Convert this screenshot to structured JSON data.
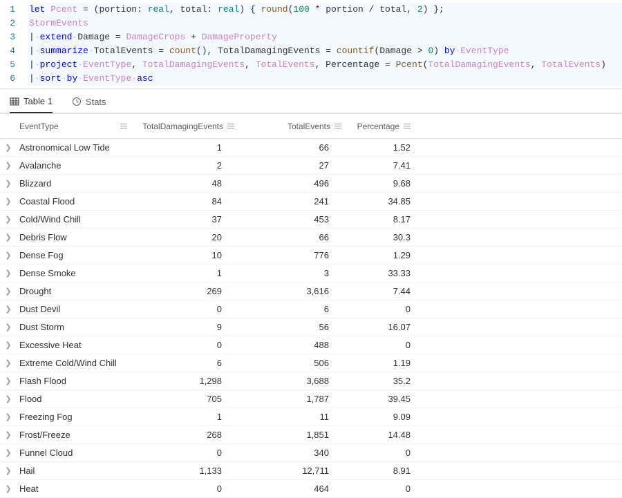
{
  "editor": {
    "lines": [
      {
        "num": "1",
        "tokens": [
          {
            "t": "let ",
            "c": "tok-kw"
          },
          {
            "t": "Pcent",
            "c": "tok-ident"
          },
          {
            "t": " = (",
            "c": "tok-op"
          },
          {
            "t": "portion",
            "c": "tok-op"
          },
          {
            "t": ": ",
            "c": "tok-op"
          },
          {
            "t": "real",
            "c": "tok-type"
          },
          {
            "t": ", ",
            "c": "tok-op"
          },
          {
            "t": "total",
            "c": "tok-op"
          },
          {
            "t": ": ",
            "c": "tok-op"
          },
          {
            "t": "real",
            "c": "tok-type"
          },
          {
            "t": ") { ",
            "c": "tok-op"
          },
          {
            "t": "round",
            "c": "tok-func"
          },
          {
            "t": "(",
            "c": "tok-op"
          },
          {
            "t": "100",
            "c": "tok-num"
          },
          {
            "t": " * portion / total, ",
            "c": "tok-op"
          },
          {
            "t": "2",
            "c": "tok-num"
          },
          {
            "t": ") };",
            "c": "tok-op"
          }
        ]
      },
      {
        "num": "2",
        "tokens": [
          {
            "t": "StormEvents",
            "c": "tok-ident"
          }
        ]
      },
      {
        "num": "3",
        "tokens": [
          {
            "t": "|",
            "c": "tok-pipe"
          },
          {
            "t": "·",
            "c": "tok-dot"
          },
          {
            "t": "extend",
            "c": "tok-kw"
          },
          {
            "t": "·",
            "c": "tok-dot"
          },
          {
            "t": "Damage",
            "c": "tok-op"
          },
          {
            "t": " = ",
            "c": "tok-op"
          },
          {
            "t": "DamageCrops",
            "c": "tok-ident"
          },
          {
            "t": " + ",
            "c": "tok-op"
          },
          {
            "t": "DamageProperty",
            "c": "tok-ident"
          }
        ]
      },
      {
        "num": "4",
        "tokens": [
          {
            "t": "|",
            "c": "tok-pipe"
          },
          {
            "t": "·",
            "c": "tok-dot"
          },
          {
            "t": "summarize",
            "c": "tok-kw"
          },
          {
            "t": "·",
            "c": "tok-dot"
          },
          {
            "t": "TotalEvents",
            "c": "tok-op"
          },
          {
            "t": " = ",
            "c": "tok-op"
          },
          {
            "t": "count",
            "c": "tok-func"
          },
          {
            "t": "(), ",
            "c": "tok-op"
          },
          {
            "t": "TotalDamagingEvents",
            "c": "tok-op"
          },
          {
            "t": " = ",
            "c": "tok-op"
          },
          {
            "t": "countif",
            "c": "tok-func"
          },
          {
            "t": "(",
            "c": "tok-op"
          },
          {
            "t": "Damage",
            "c": "tok-op"
          },
          {
            "t": " > ",
            "c": "tok-op"
          },
          {
            "t": "0",
            "c": "tok-num"
          },
          {
            "t": ") ",
            "c": "tok-op"
          },
          {
            "t": "by",
            "c": "tok-by"
          },
          {
            "t": "·",
            "c": "tok-dot"
          },
          {
            "t": "EventType",
            "c": "tok-ident"
          }
        ]
      },
      {
        "num": "5",
        "tokens": [
          {
            "t": "|",
            "c": "tok-pipe"
          },
          {
            "t": "·",
            "c": "tok-dot"
          },
          {
            "t": "project",
            "c": "tok-kw"
          },
          {
            "t": "·",
            "c": "tok-dot"
          },
          {
            "t": "EventType",
            "c": "tok-ident"
          },
          {
            "t": ", ",
            "c": "tok-op"
          },
          {
            "t": "TotalDamagingEvents",
            "c": "tok-ident"
          },
          {
            "t": ", ",
            "c": "tok-op"
          },
          {
            "t": "TotalEvents",
            "c": "tok-ident"
          },
          {
            "t": ", ",
            "c": "tok-op"
          },
          {
            "t": "Percentage",
            "c": "tok-op"
          },
          {
            "t": " = ",
            "c": "tok-op"
          },
          {
            "t": "Pcent",
            "c": "tok-func"
          },
          {
            "t": "(",
            "c": "tok-op"
          },
          {
            "t": "TotalDamagingEvents",
            "c": "tok-ident"
          },
          {
            "t": ", ",
            "c": "tok-op"
          },
          {
            "t": "TotalEvents",
            "c": "tok-ident"
          },
          {
            "t": ")",
            "c": "tok-op"
          }
        ]
      },
      {
        "num": "6",
        "tokens": [
          {
            "t": "|",
            "c": "tok-pipe"
          },
          {
            "t": "·",
            "c": "tok-dot"
          },
          {
            "t": "sort",
            "c": "tok-kw"
          },
          {
            "t": "·",
            "c": "tok-dot"
          },
          {
            "t": "by",
            "c": "tok-by"
          },
          {
            "t": "·",
            "c": "tok-dot"
          },
          {
            "t": "EventType",
            "c": "tok-ident"
          },
          {
            "t": "·",
            "c": "tok-dot"
          },
          {
            "t": "asc",
            "c": "tok-asc"
          }
        ]
      }
    ]
  },
  "tabs": {
    "table1": "Table 1",
    "stats": "Stats"
  },
  "table": {
    "columns": {
      "eventtype": "EventType",
      "totaldamaging": "TotalDamagingEvents",
      "totalevents": "TotalEvents",
      "percentage": "Percentage"
    },
    "rows": [
      {
        "event": "Astronomical Low Tide",
        "damaging": "1",
        "total": "66",
        "pct": "1.52"
      },
      {
        "event": "Avalanche",
        "damaging": "2",
        "total": "27",
        "pct": "7.41"
      },
      {
        "event": "Blizzard",
        "damaging": "48",
        "total": "496",
        "pct": "9.68"
      },
      {
        "event": "Coastal Flood",
        "damaging": "84",
        "total": "241",
        "pct": "34.85"
      },
      {
        "event": "Cold/Wind Chill",
        "damaging": "37",
        "total": "453",
        "pct": "8.17"
      },
      {
        "event": "Debris Flow",
        "damaging": "20",
        "total": "66",
        "pct": "30.3"
      },
      {
        "event": "Dense Fog",
        "damaging": "10",
        "total": "776",
        "pct": "1.29"
      },
      {
        "event": "Dense Smoke",
        "damaging": "1",
        "total": "3",
        "pct": "33.33"
      },
      {
        "event": "Drought",
        "damaging": "269",
        "total": "3,616",
        "pct": "7.44"
      },
      {
        "event": "Dust Devil",
        "damaging": "0",
        "total": "6",
        "pct": "0"
      },
      {
        "event": "Dust Storm",
        "damaging": "9",
        "total": "56",
        "pct": "16.07"
      },
      {
        "event": "Excessive Heat",
        "damaging": "0",
        "total": "488",
        "pct": "0"
      },
      {
        "event": "Extreme Cold/Wind Chill",
        "damaging": "6",
        "total": "506",
        "pct": "1.19"
      },
      {
        "event": "Flash Flood",
        "damaging": "1,298",
        "total": "3,688",
        "pct": "35.2"
      },
      {
        "event": "Flood",
        "damaging": "705",
        "total": "1,787",
        "pct": "39.45"
      },
      {
        "event": "Freezing Fog",
        "damaging": "1",
        "total": "11",
        "pct": "9.09"
      },
      {
        "event": "Frost/Freeze",
        "damaging": "268",
        "total": "1,851",
        "pct": "14.48"
      },
      {
        "event": "Funnel Cloud",
        "damaging": "0",
        "total": "340",
        "pct": "0"
      },
      {
        "event": "Hail",
        "damaging": "1,133",
        "total": "12,711",
        "pct": "8.91"
      },
      {
        "event": "Heat",
        "damaging": "0",
        "total": "464",
        "pct": "0"
      }
    ]
  }
}
